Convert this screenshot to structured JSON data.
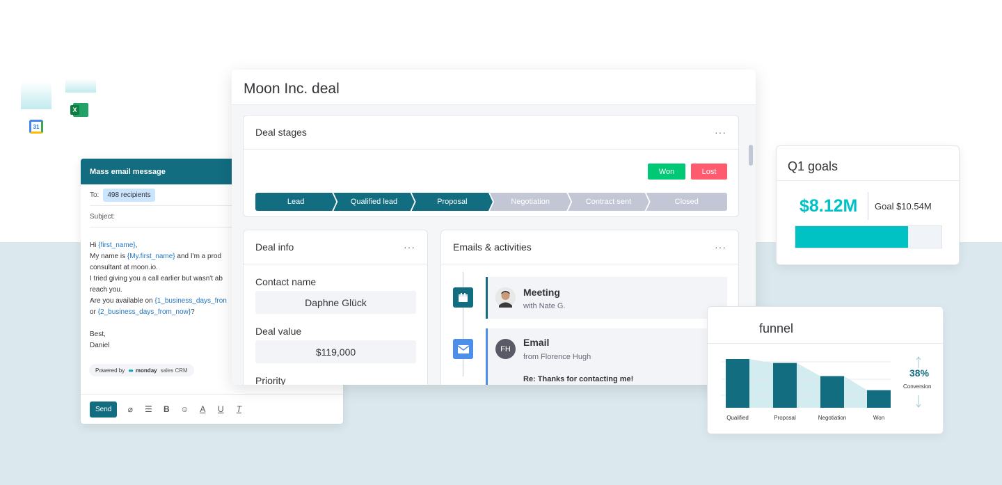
{
  "mass_email": {
    "header": "Mass email message",
    "to_label": "To:",
    "recipients": "498 recipients",
    "subject_label": "Subject:",
    "body": {
      "l1a": "Hi ",
      "l1tok": "{first_name}",
      "l1b": ",",
      "l2a": "My name is ",
      "l2tok": "{My.first_name}",
      "l2b": " and I'm a prod",
      "l3": "consultant at moon.io.",
      "l4": "I tried giving you a call earlier but wasn't ab",
      "l5": "reach you.",
      "l6a": "Are you available on ",
      "l6tok": "{1_business_days_fron",
      "l7a": "or ",
      "l7tok": "{2_business_days_from_now}",
      "l7b": "?",
      "l8": "Best,",
      "l9": "Daniel"
    },
    "powered_by": "Powered by",
    "brand": "monday",
    "brand_suffix": "sales CRM",
    "send_label": "Send"
  },
  "deal": {
    "title": "Moon Inc. deal",
    "stages_card": {
      "title": "Deal stages",
      "won_label": "Won",
      "lost_label": "Lost",
      "stages": [
        "Lead",
        "Qualified lead",
        "Proposal",
        "Negotiation",
        "Contract sent",
        "Closed"
      ],
      "active_count": 3
    },
    "info_card": {
      "title": "Deal info",
      "contact_label": "Contact name",
      "contact_value": "Daphne Glück",
      "value_label": "Deal value",
      "value_value": "$119,000",
      "priority_label": "Priority"
    },
    "activities_card": {
      "title": "Emails & activities",
      "meeting_title": "Meeting",
      "meeting_sub": "with Nate G.",
      "email_title": "Email",
      "email_sub": "from Florence Hugh",
      "email_initials": "FH",
      "email_subject": "Re: Thanks for contacting me!"
    }
  },
  "goals": {
    "title": "Q1 goals",
    "amount": "$8.12M",
    "goal": "Goal $10.54M",
    "progress": 0.77
  },
  "funnel": {
    "title": "funnel",
    "conversion_pct": "38%",
    "conversion_label": "Conversion"
  },
  "chart_data": {
    "type": "bar",
    "categories": [
      "Qualified",
      "Proposal",
      "Negotiation",
      "Won"
    ],
    "values": [
      100,
      92,
      65,
      36
    ],
    "title": "funnel",
    "ylim": [
      0,
      100
    ]
  },
  "colors": {
    "brand": "#126d80",
    "accent": "#00c2c5",
    "won": "#00c875",
    "lost": "#ff5a6e",
    "inactive": "#c3c6d4"
  },
  "icons": {
    "calendar_app": "google-calendar-icon",
    "excel_app": "excel-icon"
  }
}
